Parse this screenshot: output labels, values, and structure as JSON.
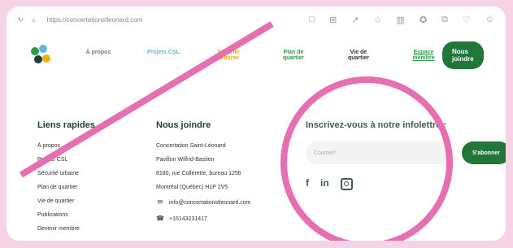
{
  "browser": {
    "url": "https://concertationstleonard.com"
  },
  "header": {
    "nav_items": [
      {
        "label": "À propos"
      },
      {
        "label": "Projets CSL"
      },
      {
        "label": "Sécurité urbaine"
      },
      {
        "label": "Plan de quartier"
      },
      {
        "label": "Vie de quartier"
      },
      {
        "label": "Espace membre"
      }
    ],
    "cta": "Nous joindre"
  },
  "footer": {
    "quick_links": {
      "title": "Liens rapides",
      "items": [
        "À propos",
        "Projets CSL",
        "Sécurité urbaine",
        "Plan de quartier",
        "Vie de quartier",
        "Publications",
        "Devenir membre"
      ]
    },
    "contact": {
      "title": "Nous joindre",
      "org": "Concertation Saint-Léonard",
      "building": "Pavillon Wilfrid-Bastien",
      "address": "8180, rue Collerette, bureau 1256",
      "city": "Montréal (Québec) H1P 2V5",
      "email": "info@concertationstleonard.com",
      "phone": "+15143231417"
    },
    "newsletter": {
      "title": "Inscrivez-vous à notre infolettre :",
      "placeholder": "Courriel*",
      "button": "S'abonner"
    },
    "social": [
      "facebook-icon",
      "linkedin-icon",
      "instagram-icon"
    ]
  }
}
